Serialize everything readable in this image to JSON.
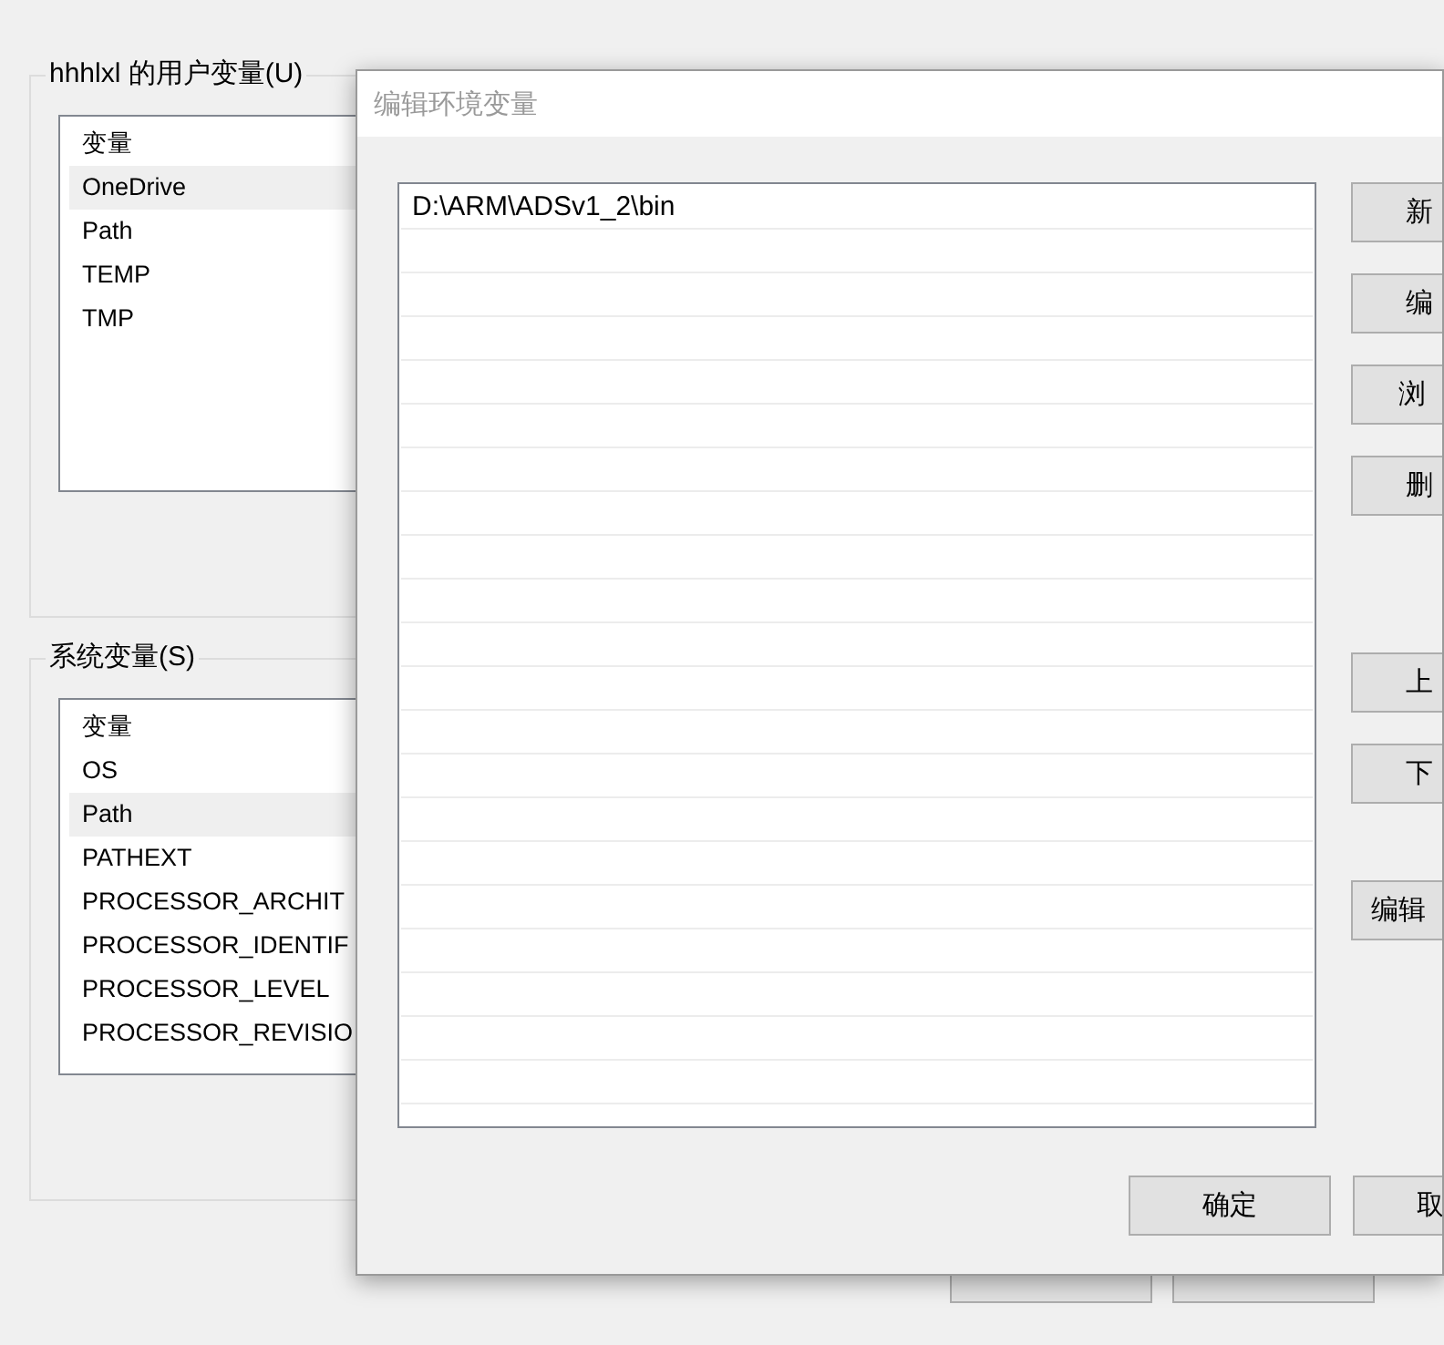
{
  "background_window": {
    "groups": [
      {
        "title": "hhhlxl 的用户变量(U)",
        "header": "变量",
        "rows": [
          {
            "name": "OneDrive",
            "selected": true
          },
          {
            "name": "Path",
            "selected": false
          },
          {
            "name": "TEMP",
            "selected": false
          },
          {
            "name": "TMP",
            "selected": false
          }
        ]
      },
      {
        "title": "系统变量(S)",
        "header": "变量",
        "rows": [
          {
            "name": "OS",
            "selected": false
          },
          {
            "name": "Path",
            "selected": true
          },
          {
            "name": "PATHEXT",
            "selected": false
          },
          {
            "name": "PROCESSOR_ARCHIT",
            "selected": false
          },
          {
            "name": "PROCESSOR_IDENTIF",
            "selected": false
          },
          {
            "name": "PROCESSOR_LEVEL",
            "selected": false
          },
          {
            "name": "PROCESSOR_REVISIO",
            "selected": false
          }
        ]
      }
    ]
  },
  "dialog": {
    "title": "编辑环境变量",
    "entries": [
      {
        "text": "D:\\ARM\\ADSv1_2\\bin",
        "selected": false
      }
    ],
    "side_buttons": [
      "新",
      "编",
      "浏",
      "删",
      "上",
      "下",
      "编辑"
    ],
    "footer_buttons": [
      "确定",
      "取"
    ]
  }
}
